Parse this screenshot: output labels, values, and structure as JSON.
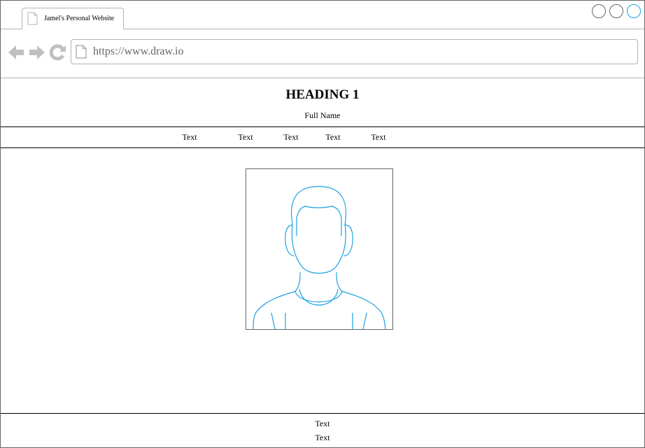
{
  "browser": {
    "tab_title": "Jamel's Personal Website",
    "url": "https://www.draw.io"
  },
  "page": {
    "heading": "HEADING 1",
    "subheading": "Full Name",
    "menu": [
      "Text",
      "Text",
      "Text",
      "Text",
      "Text"
    ],
    "photo_icon": "user-avatar-icon",
    "footer": [
      "Text",
      "Text"
    ]
  },
  "colors": {
    "accent": "#1ba1e2",
    "chrome_border": "#b3b3b3",
    "nav_icons": "#c0c0c0"
  }
}
